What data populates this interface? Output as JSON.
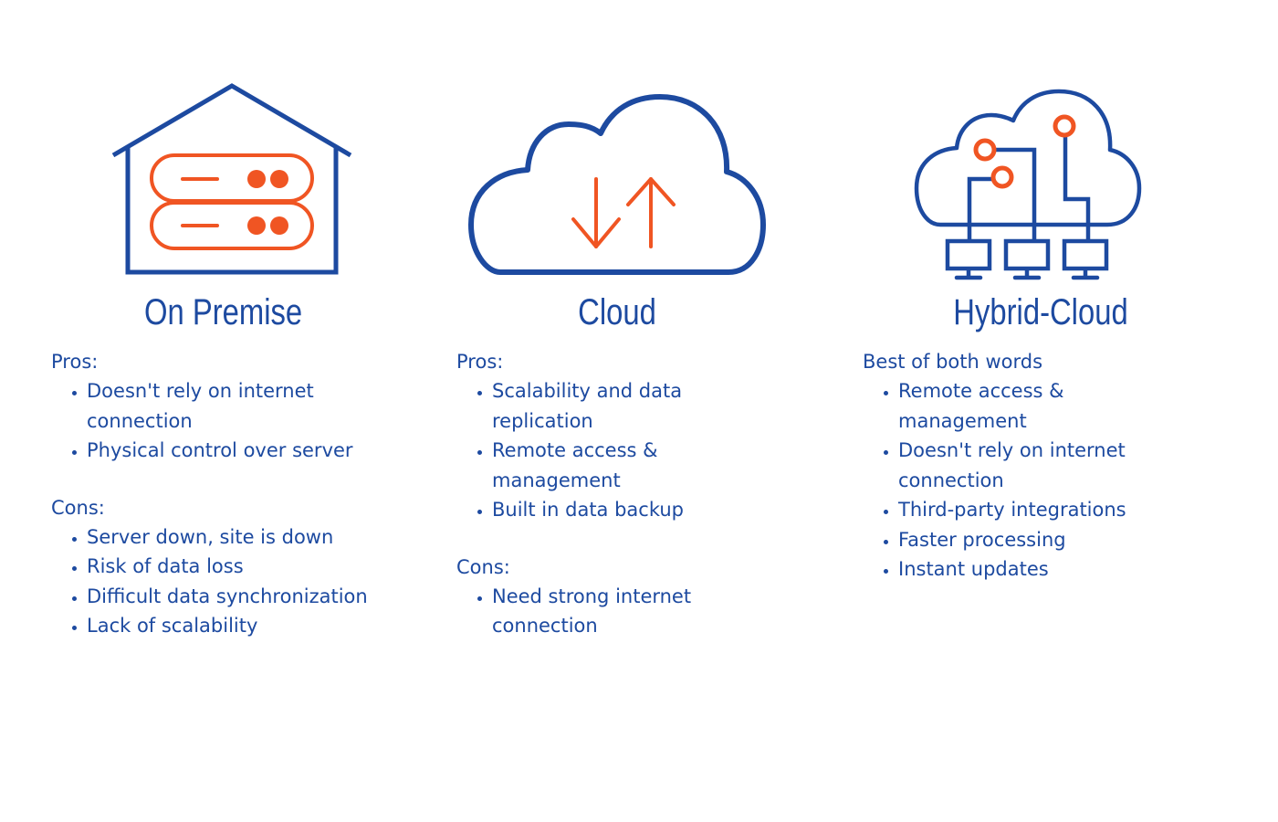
{
  "colors": {
    "primary": "#1d4aa0",
    "accent": "#f05523",
    "background": "#ffffff"
  },
  "columns": [
    {
      "icon": "house-server-icon",
      "title": "On Premise",
      "sections": [
        {
          "label": "Pros:",
          "items": [
            "Doesn't rely on internet connection",
            "Physical control over server"
          ]
        },
        {
          "label": "Cons:",
          "items": [
            "Server down, site is down",
            "Risk of data loss",
            "Difficult data synchronization",
            "Lack of scalability"
          ]
        }
      ]
    },
    {
      "icon": "cloud-transfer-icon",
      "title": "Cloud",
      "sections": [
        {
          "label": "Pros:",
          "items": [
            "Scalability and data replication",
            "Remote access & management",
            "Built in data backup"
          ]
        },
        {
          "label": "Cons:",
          "items": [
            "Need strong internet connection"
          ]
        }
      ]
    },
    {
      "icon": "hybrid-cloud-network-icon",
      "title": "Hybrid-Cloud",
      "sections": [
        {
          "label": "Best of both words",
          "items": [
            "Remote access & management",
            "Doesn't rely on internet connection",
            "Third-party integrations",
            "Faster processing",
            "Instant updates"
          ]
        }
      ]
    }
  ]
}
